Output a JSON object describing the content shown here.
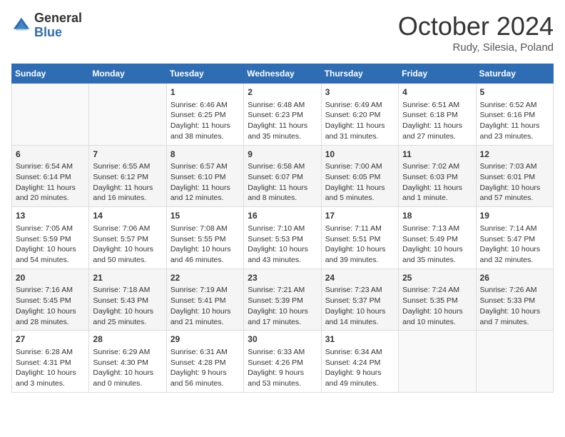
{
  "header": {
    "logo": {
      "general": "General",
      "blue": "Blue"
    },
    "title": "October 2024",
    "location": "Rudy, Silesia, Poland"
  },
  "days_of_week": [
    "Sunday",
    "Monday",
    "Tuesday",
    "Wednesday",
    "Thursday",
    "Friday",
    "Saturday"
  ],
  "weeks": [
    [
      {
        "day": "",
        "content": ""
      },
      {
        "day": "",
        "content": ""
      },
      {
        "day": "1",
        "content": "Sunrise: 6:46 AM\nSunset: 6:25 PM\nDaylight: 11 hours and 38 minutes."
      },
      {
        "day": "2",
        "content": "Sunrise: 6:48 AM\nSunset: 6:23 PM\nDaylight: 11 hours and 35 minutes."
      },
      {
        "day": "3",
        "content": "Sunrise: 6:49 AM\nSunset: 6:20 PM\nDaylight: 11 hours and 31 minutes."
      },
      {
        "day": "4",
        "content": "Sunrise: 6:51 AM\nSunset: 6:18 PM\nDaylight: 11 hours and 27 minutes."
      },
      {
        "day": "5",
        "content": "Sunrise: 6:52 AM\nSunset: 6:16 PM\nDaylight: 11 hours and 23 minutes."
      }
    ],
    [
      {
        "day": "6",
        "content": "Sunrise: 6:54 AM\nSunset: 6:14 PM\nDaylight: 11 hours and 20 minutes."
      },
      {
        "day": "7",
        "content": "Sunrise: 6:55 AM\nSunset: 6:12 PM\nDaylight: 11 hours and 16 minutes."
      },
      {
        "day": "8",
        "content": "Sunrise: 6:57 AM\nSunset: 6:10 PM\nDaylight: 11 hours and 12 minutes."
      },
      {
        "day": "9",
        "content": "Sunrise: 6:58 AM\nSunset: 6:07 PM\nDaylight: 11 hours and 8 minutes."
      },
      {
        "day": "10",
        "content": "Sunrise: 7:00 AM\nSunset: 6:05 PM\nDaylight: 11 hours and 5 minutes."
      },
      {
        "day": "11",
        "content": "Sunrise: 7:02 AM\nSunset: 6:03 PM\nDaylight: 11 hours and 1 minute."
      },
      {
        "day": "12",
        "content": "Sunrise: 7:03 AM\nSunset: 6:01 PM\nDaylight: 10 hours and 57 minutes."
      }
    ],
    [
      {
        "day": "13",
        "content": "Sunrise: 7:05 AM\nSunset: 5:59 PM\nDaylight: 10 hours and 54 minutes."
      },
      {
        "day": "14",
        "content": "Sunrise: 7:06 AM\nSunset: 5:57 PM\nDaylight: 10 hours and 50 minutes."
      },
      {
        "day": "15",
        "content": "Sunrise: 7:08 AM\nSunset: 5:55 PM\nDaylight: 10 hours and 46 minutes."
      },
      {
        "day": "16",
        "content": "Sunrise: 7:10 AM\nSunset: 5:53 PM\nDaylight: 10 hours and 43 minutes."
      },
      {
        "day": "17",
        "content": "Sunrise: 7:11 AM\nSunset: 5:51 PM\nDaylight: 10 hours and 39 minutes."
      },
      {
        "day": "18",
        "content": "Sunrise: 7:13 AM\nSunset: 5:49 PM\nDaylight: 10 hours and 35 minutes."
      },
      {
        "day": "19",
        "content": "Sunrise: 7:14 AM\nSunset: 5:47 PM\nDaylight: 10 hours and 32 minutes."
      }
    ],
    [
      {
        "day": "20",
        "content": "Sunrise: 7:16 AM\nSunset: 5:45 PM\nDaylight: 10 hours and 28 minutes."
      },
      {
        "day": "21",
        "content": "Sunrise: 7:18 AM\nSunset: 5:43 PM\nDaylight: 10 hours and 25 minutes."
      },
      {
        "day": "22",
        "content": "Sunrise: 7:19 AM\nSunset: 5:41 PM\nDaylight: 10 hours and 21 minutes."
      },
      {
        "day": "23",
        "content": "Sunrise: 7:21 AM\nSunset: 5:39 PM\nDaylight: 10 hours and 17 minutes."
      },
      {
        "day": "24",
        "content": "Sunrise: 7:23 AM\nSunset: 5:37 PM\nDaylight: 10 hours and 14 minutes."
      },
      {
        "day": "25",
        "content": "Sunrise: 7:24 AM\nSunset: 5:35 PM\nDaylight: 10 hours and 10 minutes."
      },
      {
        "day": "26",
        "content": "Sunrise: 7:26 AM\nSunset: 5:33 PM\nDaylight: 10 hours and 7 minutes."
      }
    ],
    [
      {
        "day": "27",
        "content": "Sunrise: 6:28 AM\nSunset: 4:31 PM\nDaylight: 10 hours and 3 minutes."
      },
      {
        "day": "28",
        "content": "Sunrise: 6:29 AM\nSunset: 4:30 PM\nDaylight: 10 hours and 0 minutes."
      },
      {
        "day": "29",
        "content": "Sunrise: 6:31 AM\nSunset: 4:28 PM\nDaylight: 9 hours and 56 minutes."
      },
      {
        "day": "30",
        "content": "Sunrise: 6:33 AM\nSunset: 4:26 PM\nDaylight: 9 hours and 53 minutes."
      },
      {
        "day": "31",
        "content": "Sunrise: 6:34 AM\nSunset: 4:24 PM\nDaylight: 9 hours and 49 minutes."
      },
      {
        "day": "",
        "content": ""
      },
      {
        "day": "",
        "content": ""
      }
    ]
  ]
}
